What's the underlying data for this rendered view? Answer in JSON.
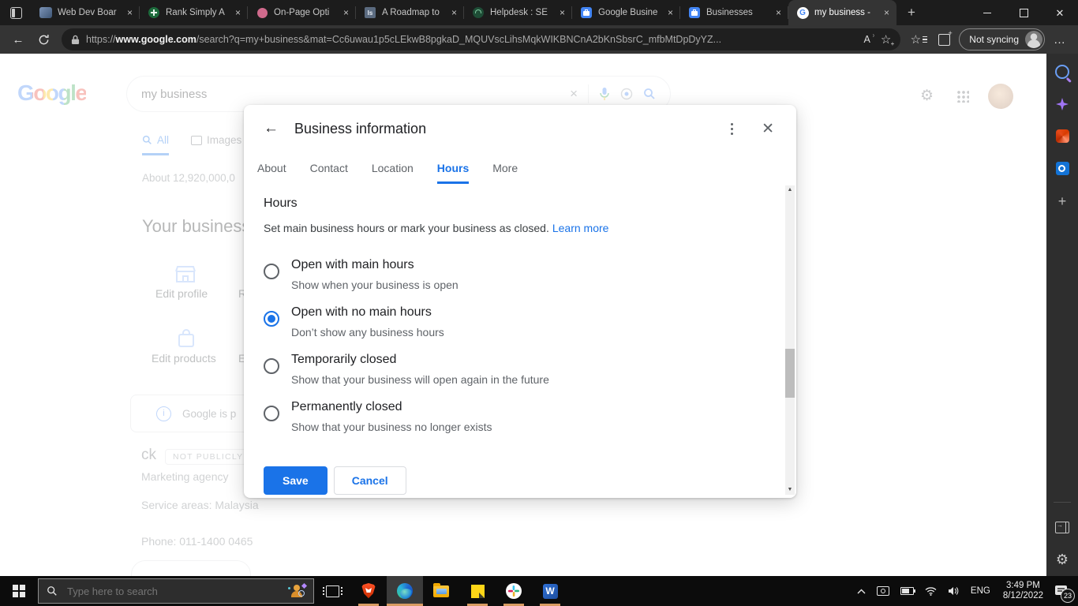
{
  "browser": {
    "tabs": [
      {
        "title": "Web Dev Boar"
      },
      {
        "title": "Rank Simply A"
      },
      {
        "title": "On-Page Opti"
      },
      {
        "title": "A Roadmap to",
        "favicon_text": "Is"
      },
      {
        "title": "Helpdesk : SE"
      },
      {
        "title": "Google Busine"
      },
      {
        "title": "Businesses"
      },
      {
        "title": "my business -",
        "favicon_text": "G"
      }
    ],
    "address": {
      "scheme": "https://",
      "host": "www.google.com",
      "rest": "/search?q=my+business&mat=Cc6uwau1p5cLEkwB8pgkaD_MQUVscLihsMqkWIKBNCnA2bKnSbsrC_mfbMtDpDyYZ..."
    },
    "profile_label": "Not syncing"
  },
  "page": {
    "logo": "Google",
    "search_value": "my business",
    "tab_all": "All",
    "tab_images": "Images",
    "results_stat": "About 12,920,000,0",
    "section_title": "Your business",
    "card_edit_profile": "Edit profile",
    "card_edit_profile_more": "R",
    "card_edit_products": "Edit products",
    "card_edit_products_more": "E",
    "info_text": "Google is p",
    "name_fragment": "ck",
    "visibility_badge": "NOT PUBLICLY",
    "category": "Marketing agency",
    "service_areas": "Service areas: Malaysia",
    "phone": "Phone: 011-1400 0465"
  },
  "modal": {
    "title": "Business information",
    "tabs": [
      {
        "label": "About"
      },
      {
        "label": "Contact"
      },
      {
        "label": "Location"
      },
      {
        "label": "Hours"
      },
      {
        "label": "More"
      }
    ],
    "heading": "Hours",
    "description": "Set main business hours or mark your business as closed.",
    "learn_more_label": "Learn more",
    "options": [
      {
        "title": "Open with main hours",
        "subtitle": "Show when your business is open"
      },
      {
        "title": "Open with no main hours",
        "subtitle": "Don’t show any business hours"
      },
      {
        "title": "Temporarily closed",
        "subtitle": "Show that your business will open again in the future"
      },
      {
        "title": "Permanently closed",
        "subtitle": "Show that your business no longer exists"
      }
    ],
    "save_label": "Save",
    "cancel_label": "Cancel"
  },
  "taskbar": {
    "search_placeholder": "Type here to search",
    "word_glyph": "W",
    "tray": {
      "language": "ENG",
      "time": "3:49 PM",
      "date": "8/12/2022",
      "notification_count": "23"
    }
  },
  "colors": {
    "accent": "#1a73e8",
    "running_indicator": "#d89b62",
    "selected_radio": "#1a73e8"
  }
}
